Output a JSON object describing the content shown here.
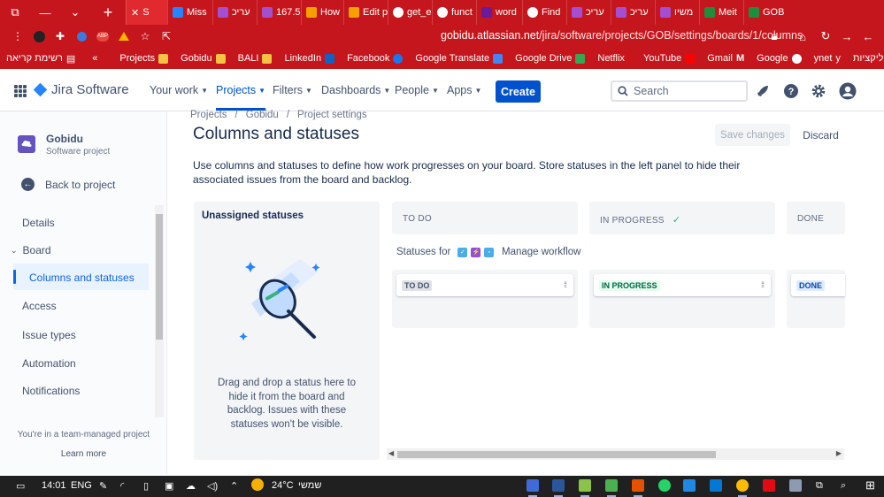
{
  "browser": {
    "tabs": [
      {
        "label": "S",
        "color": "#0052cc",
        "active": true
      },
      {
        "label": "Miss",
        "color": "#2684ff"
      },
      {
        "label": "עריכ",
        "color": "#a34fd0"
      },
      {
        "label": "167.5",
        "color": "#a34fd0"
      },
      {
        "label": "How",
        "color": "#f6a000"
      },
      {
        "label": "Edit p",
        "color": "#f6a000"
      },
      {
        "label": "get_e",
        "color": "#ffffff"
      },
      {
        "label": "funct",
        "color": "#ffffff"
      },
      {
        "label": "word",
        "color": "#6a1b9a"
      },
      {
        "label": "Find",
        "color": "#ffffff"
      },
      {
        "label": "עריכ",
        "color": "#a34fd0"
      },
      {
        "label": "עריכ",
        "color": "#a34fd0"
      },
      {
        "label": "משיו",
        "color": "#a34fd0"
      },
      {
        "label": "Meit",
        "color": "#1e8e3e"
      },
      {
        "label": "GOB",
        "color": "#1e8e3e"
      }
    ],
    "url": "gobidu.atlassian.net/jira/software/projects/GOB/settings/boards/1/columns",
    "url_host": "gobidu.atlassian.net",
    "url_path": "/jira/software/projects/GOB/settings/boards/1/columns",
    "reading_list": "רשימת קריאה",
    "bookmarks": [
      {
        "label": "Projects",
        "color": "#f6c343"
      },
      {
        "label": "Gobidu",
        "color": "#f6c343"
      },
      {
        "label": "BALI",
        "color": "#f6c343"
      },
      {
        "label": "LinkedIn",
        "color": "#0a66c2"
      },
      {
        "label": "Facebook",
        "color": "#1877f2"
      },
      {
        "label": "Google Translate",
        "color": "#4285f4"
      },
      {
        "label": "Google Drive",
        "color": "#34a853"
      },
      {
        "label": "Netflix",
        "color": "#e50914"
      },
      {
        "label": "YouTube",
        "color": "#ff0000"
      },
      {
        "label": "Gmail",
        "color": "#ea4335"
      },
      {
        "label": "Google",
        "color": "#ffffff"
      },
      {
        "label": "ynet",
        "color": "#d00000"
      },
      {
        "label": "אפליקציות",
        "color": "#ffffff"
      }
    ],
    "brand_color": "#c4161c"
  },
  "nav": {
    "product": "Jira Software",
    "items": [
      "Your work",
      "Projects",
      "Filters",
      "Dashboards",
      "People",
      "Apps"
    ],
    "create": "Create",
    "search_placeholder": "Search"
  },
  "sidebar": {
    "project_name": "Gobidu",
    "project_type": "Software project",
    "back": "Back to project",
    "details": "Details",
    "board": "Board",
    "active": "Columns and statuses",
    "items": [
      "Access",
      "Issue types",
      "Automation",
      "Notifications"
    ],
    "footer": "You're in a team-managed project",
    "learn_more": "Learn more"
  },
  "main": {
    "breadcrumbs": [
      "Projects",
      "/",
      "Gobidu",
      "/",
      "Project settings"
    ],
    "title": "Columns and statuses",
    "save": "Save changes",
    "discard": "Discard",
    "description": "Use columns and statuses to define how work progresses on your board. Store statuses in the left panel to hide their associated issues from the board and backlog.",
    "unassigned_title": "Unassigned statuses",
    "unassigned_hint": "Drag and drop a status here to hide it from the board and backlog. Issues with these statuses won't be visible.",
    "statuses_for": "Statuses for",
    "manage_workflow": "Manage workflow",
    "columns": [
      {
        "name": "TO DO",
        "status": "TO DO",
        "lozenge_bg": "#dfe1e6",
        "lozenge_fg": "#42526e"
      },
      {
        "name": "IN PROGRESS",
        "status": "IN PROGRESS",
        "lozenge_bg": "#e3fcef",
        "lozenge_fg": "#006644"
      },
      {
        "name": "DONE",
        "status": "DONE",
        "lozenge_bg": "#deebff",
        "lozenge_fg": "#0747a6"
      }
    ]
  },
  "taskbar": {
    "time": "14:01",
    "lang": "ENG",
    "temp": "24°C",
    "weather": "שמשי"
  }
}
